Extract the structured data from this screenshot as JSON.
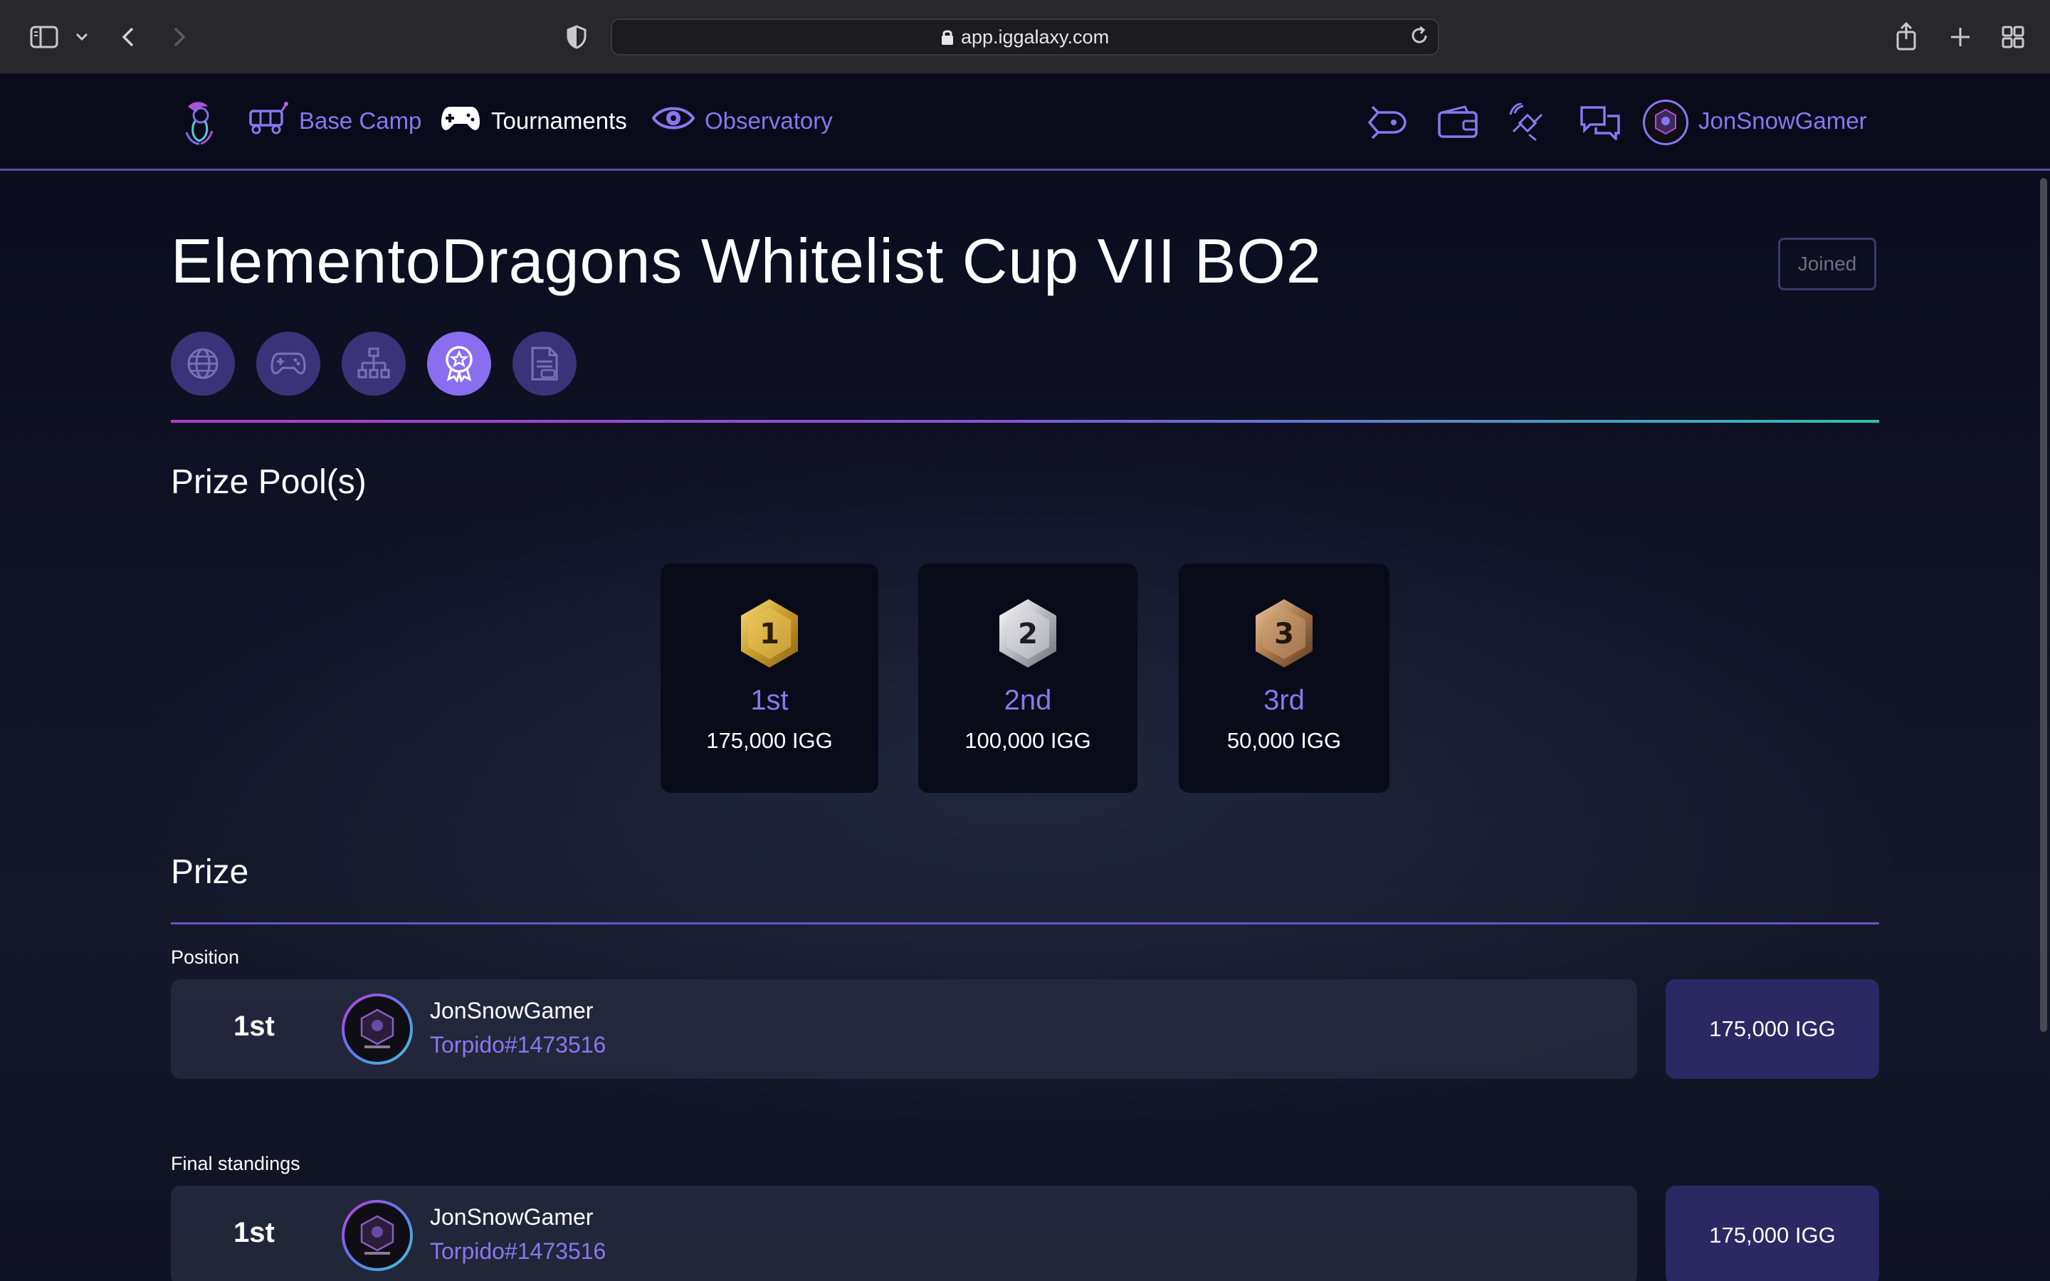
{
  "browser": {
    "url": "app.iggalaxy.com"
  },
  "nav": {
    "items": [
      {
        "label": "Base Camp",
        "icon": "rover-icon"
      },
      {
        "label": "Tournaments",
        "icon": "gamepad-icon"
      },
      {
        "label": "Observatory",
        "icon": "eye-icon"
      }
    ],
    "right_icons": [
      "rocket-icon",
      "wallet-icon",
      "satellite-icon",
      "chat-icon"
    ],
    "username": "JonSnowGamer"
  },
  "tournament": {
    "title": "ElementoDragons Whitelist Cup VII BO2",
    "status_badge": "Joined",
    "tabs": [
      {
        "icon": "globe-icon",
        "active": false
      },
      {
        "icon": "gamepad-icon",
        "active": false
      },
      {
        "icon": "bracket-icon",
        "active": false
      },
      {
        "icon": "award-icon",
        "active": true
      },
      {
        "icon": "document-icon",
        "active": false
      }
    ]
  },
  "prize_pools": {
    "heading": "Prize Pool(s)",
    "cards": [
      {
        "medal_number": "1",
        "place": "1st",
        "amount": "175,000 IGG",
        "medal": "gold"
      },
      {
        "medal_number": "2",
        "place": "2nd",
        "amount": "100,000 IGG",
        "medal": "silver"
      },
      {
        "medal_number": "3",
        "place": "3rd",
        "amount": "50,000 IGG",
        "medal": "bronze"
      }
    ]
  },
  "prize": {
    "heading": "Prize",
    "position_label": "Position",
    "position_row": {
      "place": "1st",
      "name": "JonSnowGamer",
      "tag": "Torpido#1473516",
      "amount": "175,000 IGG"
    },
    "final_label": "Final standings",
    "final_row": {
      "place": "1st",
      "name": "JonSnowGamer",
      "tag": "Torpido#1473516",
      "amount": "175,000 IGG"
    }
  },
  "colors": {
    "accent": "#8b76f0",
    "nav_bg": "#090b1a",
    "tab_bg": "#3b3379",
    "tab_active": "#8a6ef0",
    "amount_box": "#2c2863"
  }
}
